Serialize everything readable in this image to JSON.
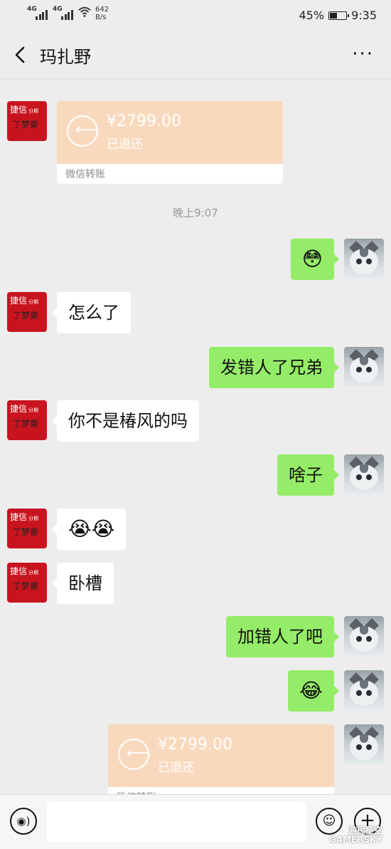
{
  "status_bar": {
    "signal1": "4G",
    "signal2": "4G",
    "speed_value": "642",
    "speed_unit": "B/s",
    "battery": "45%",
    "battery_level": 0.45,
    "time": "9:35"
  },
  "header": {
    "title": "玛扎野",
    "more": "···"
  },
  "brand_avatar": {
    "line1": "捷信",
    "line1_small": "分期",
    "line2": "丁梦豪"
  },
  "transfer_in": {
    "amount": "¥2799.00",
    "status": "已退还",
    "footer": "微信转账"
  },
  "timestamp": "晚上9:07",
  "messages": [
    {
      "side": "out",
      "text": "😳"
    },
    {
      "side": "in",
      "text": "怎么了"
    },
    {
      "side": "out",
      "text": "发错人了兄弟"
    },
    {
      "side": "in",
      "text": "你不是椿风的吗"
    },
    {
      "side": "out",
      "text": "啥子"
    },
    {
      "side": "in",
      "text": "😭😭"
    },
    {
      "side": "in",
      "text": "卧槽"
    },
    {
      "side": "out",
      "text": "加错人了吧"
    },
    {
      "side": "out",
      "text": "😂"
    }
  ],
  "transfer_out": {
    "amount": "¥2799.00",
    "status": "已退还",
    "footer": "微信转账"
  },
  "watermark": {
    "line1": "游民星空",
    "line2": "GAMERSKY"
  },
  "colors": {
    "outgoing_bubble": "#95ec69",
    "transfer_card": "#f9d9bd",
    "brand_red": "#c8141f"
  }
}
